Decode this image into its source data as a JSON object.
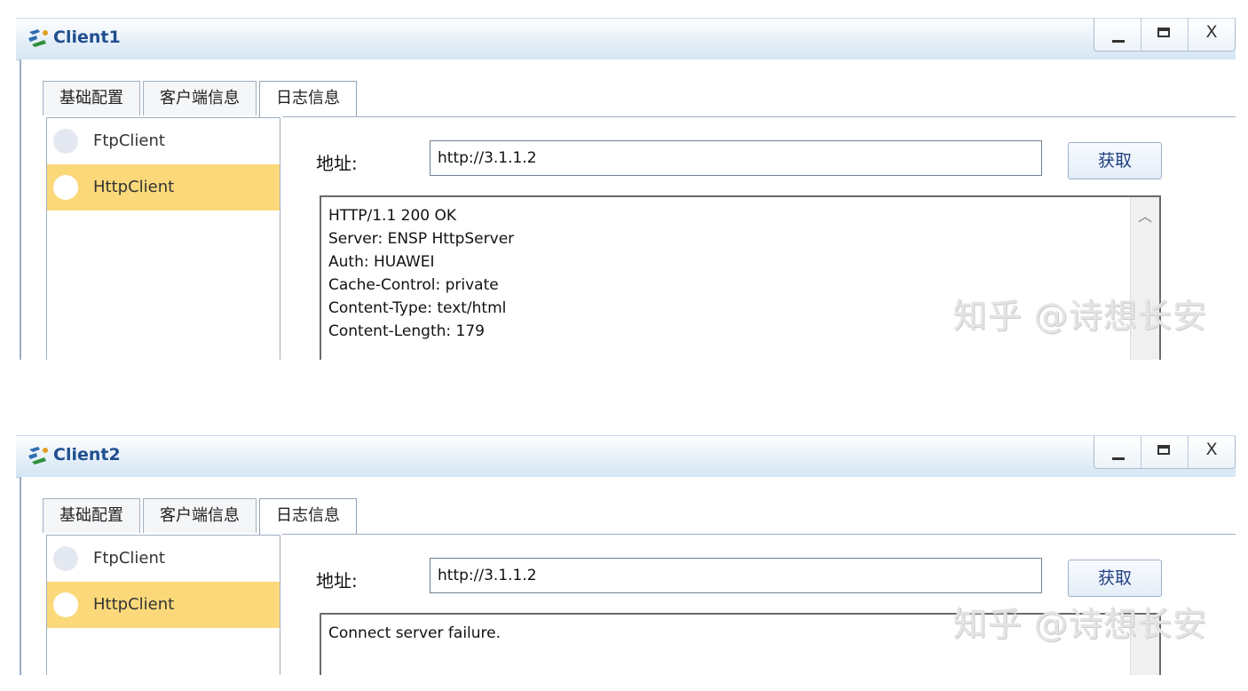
{
  "windows": [
    {
      "title": "Client1",
      "controls": {
        "minimize": "_",
        "maximize": "□",
        "close": "X"
      },
      "tabs": [
        {
          "label": "基础配置"
        },
        {
          "label": "客户端信息"
        },
        {
          "label": "日志信息"
        }
      ],
      "active_tab": "日志信息",
      "sidebar": [
        {
          "label": "FtpClient",
          "selected": false
        },
        {
          "label": "HttpClient",
          "selected": true
        }
      ],
      "address_label": "地址:",
      "address_value": "http://3.1.1.2",
      "fetch_button": "获取",
      "response_lines": [
        "HTTP/1.1 200 OK",
        "Server: ENSP HttpServer",
        "Auth: HUAWEI",
        "Cache-Control: private",
        "Content-Type: text/html",
        "Content-Length: 179"
      ],
      "watermark": "知乎 @诗想长安"
    },
    {
      "title": "Client2",
      "controls": {
        "minimize": "_",
        "maximize": "□",
        "close": "X"
      },
      "tabs": [
        {
          "label": "基础配置"
        },
        {
          "label": "客户端信息"
        },
        {
          "label": "日志信息"
        }
      ],
      "active_tab": "日志信息",
      "sidebar": [
        {
          "label": "FtpClient",
          "selected": false
        },
        {
          "label": "HttpClient",
          "selected": true
        }
      ],
      "address_label": "地址:",
      "address_value": "http://3.1.1.2",
      "fetch_button": "获取",
      "response_lines": [
        "Connect server failure."
      ],
      "watermark": "知乎 @诗想长安"
    }
  ],
  "colors": {
    "titlebar_top": "#ffffff",
    "titlebar_bottom": "#d6e6f3",
    "title_text": "#1f4f8f",
    "selected_item": "#fbd97a"
  }
}
